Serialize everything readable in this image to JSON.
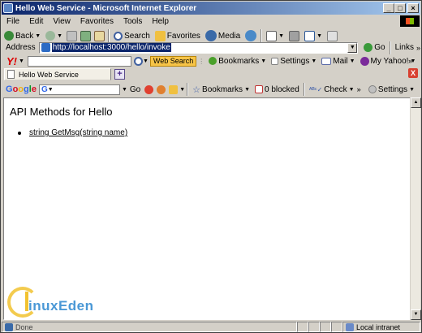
{
  "window": {
    "title": "Hello Web Service - Microsoft Internet Explorer"
  },
  "menubar": {
    "items": [
      "File",
      "Edit",
      "View",
      "Favorites",
      "Tools",
      "Help"
    ]
  },
  "toolbar": {
    "back_label": "Back",
    "search_label": "Search",
    "favorites_label": "Favorites",
    "media_label": "Media"
  },
  "address": {
    "label": "Address",
    "url": "http://localhost:3000/hello/invoke",
    "go_label": "Go",
    "links_label": "Links"
  },
  "yahoo": {
    "logo": "Y!",
    "search_button": "Web Search",
    "bookmarks_label": "Bookmarks",
    "settings_label": "Settings",
    "mail_label": "Mail",
    "myyahoo_label": "My Yahoo!"
  },
  "tabs": {
    "active_tab_label": "Hello Web Service",
    "new_tab_label": "+",
    "close_label": "X"
  },
  "google": {
    "logo": [
      "G",
      "o",
      "o",
      "g",
      "l",
      "e"
    ],
    "field_prefix": "G",
    "go_label": "Go",
    "bookmarks_label": "Bookmarks",
    "blocked_label": "0 blocked",
    "check_label": "Check",
    "settings_label": "Settings"
  },
  "page": {
    "heading": "API Methods for Hello",
    "methods": [
      {
        "label": "string GetMsg(string name)"
      }
    ]
  },
  "watermark": {
    "text": "inuxEden"
  },
  "status": {
    "text": "Done",
    "zone_label": "Local intranet"
  },
  "colors": {
    "title_gradient_start": "#0a246a",
    "title_gradient_end": "#a6caf0",
    "chrome": "#d4d0c8",
    "selection": "#0a246a"
  }
}
